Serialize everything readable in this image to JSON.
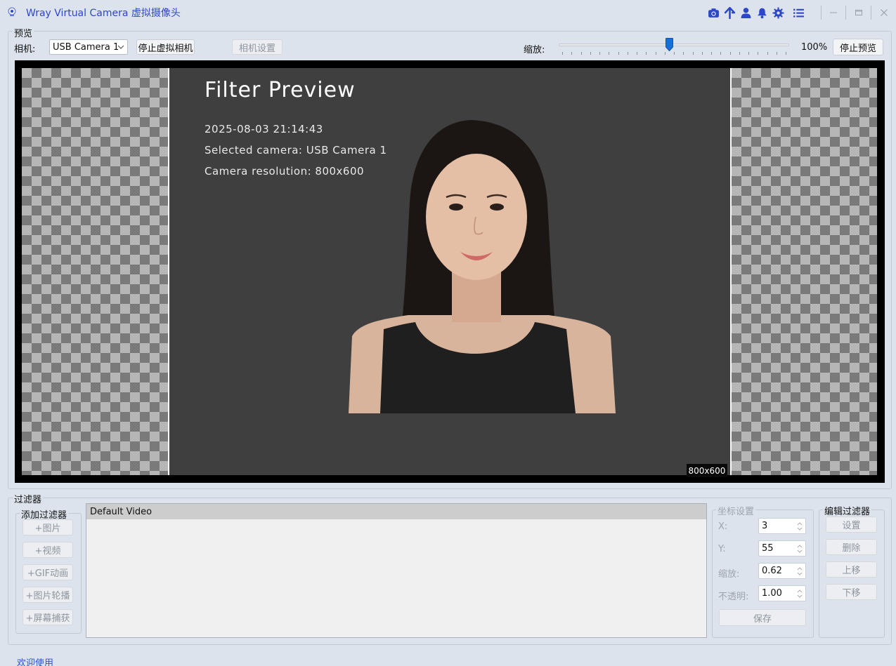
{
  "window": {
    "title": "Wray Virtual Camera 虚拟摄像头",
    "toolbar_icons": [
      "camera-icon",
      "upload-arrow-icon",
      "user-icon",
      "bell-icon",
      "gear-icon",
      "list-icon"
    ],
    "controls": [
      "minimize-icon",
      "maximize-icon",
      "close-icon"
    ]
  },
  "preview": {
    "group_title": "预览",
    "camera_label": "相机:",
    "camera_selected": "USB Camera 1",
    "stop_virtual_camera": "停止虚拟相机",
    "camera_settings": "相机设置",
    "zoom_label": "缩放:",
    "zoom_value": "100%",
    "zoom_fraction": 0.48,
    "stop_preview": "停止预览",
    "overlay": {
      "title": "Filter Preview",
      "datetime": "2025-08-03 21:14:43",
      "selected_camera": "Selected camera: USB Camera 1",
      "resolution": "Camera resolution: 800x600"
    },
    "resolution_badge": "800x600"
  },
  "filters": {
    "group_title": "过滤器",
    "add_group_title": "添加过滤器",
    "add_buttons": [
      "+图片",
      "+视频",
      "+GIF动画",
      "+图片轮播",
      "+屏幕捕获"
    ],
    "list_items": [
      "Default Video"
    ],
    "coords": {
      "group_title": "坐标设置",
      "x_label": "X:",
      "x_value": "3",
      "y_label": "Y:",
      "y_value": "55",
      "scale_label": "缩放:",
      "scale_value": "0.62",
      "opacity_label": "不透明:",
      "opacity_value": "1.00",
      "save": "保存"
    },
    "edit": {
      "group_title": "编辑过滤器",
      "buttons": [
        "设置",
        "删除",
        "上移",
        "下移"
      ]
    }
  },
  "status_text": "欢迎使用",
  "colors": {
    "accent": "#2d47c9",
    "window_bg": "#dde3ec",
    "preview_bg": "#3f3f3f",
    "link": "#2a55d6"
  }
}
